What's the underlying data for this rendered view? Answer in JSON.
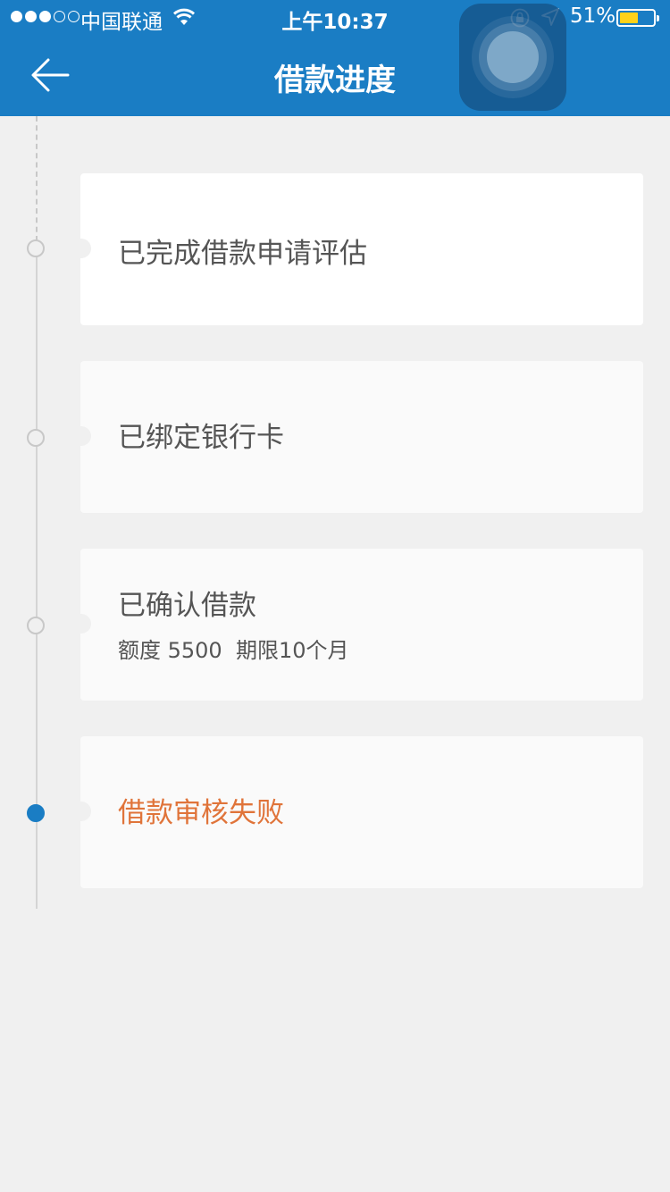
{
  "status_bar": {
    "carrier": "中国联通",
    "time": "上午10:37",
    "battery_percent": "51%",
    "battery_level": 0.51,
    "signal_bars_filled": 3,
    "signal_bars_total": 5
  },
  "nav": {
    "title": "借款进度",
    "back_icon": "arrow-left-icon"
  },
  "colors": {
    "header_bg": "#1a7dc4",
    "active_node": "#1a7dc4",
    "fail_text": "#e0743a",
    "battery": "#ffd21a"
  },
  "steps": [
    {
      "title": "已完成借款申请评估",
      "status": "done"
    },
    {
      "title": "已绑定银行卡",
      "status": "done"
    },
    {
      "title": "已确认借款",
      "detail": "额度 5500  期限10个月",
      "status": "done"
    },
    {
      "title": "借款审核失败",
      "status": "failed-current"
    }
  ]
}
